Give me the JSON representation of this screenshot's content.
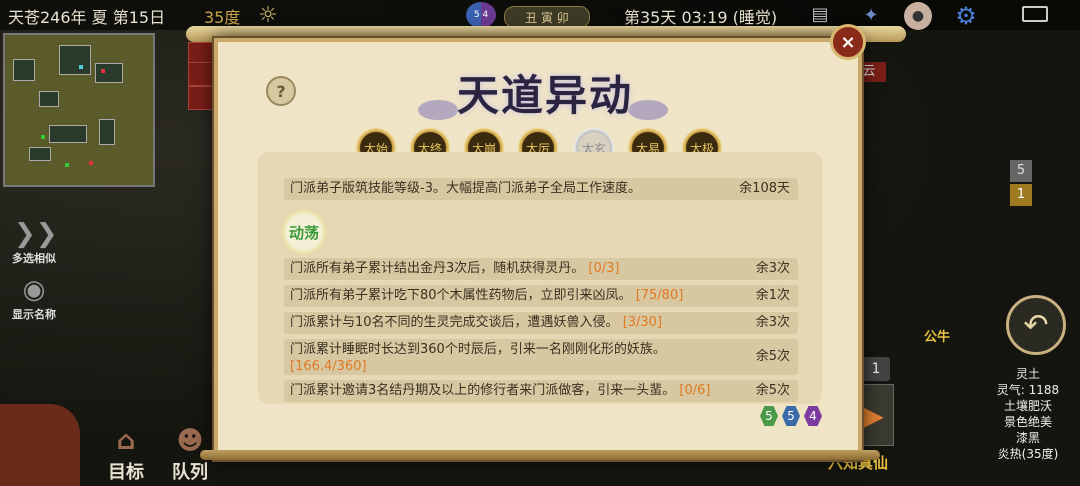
{
  "topbar": {
    "date": "天苍246年 夏 第15日",
    "temperature": "35度",
    "zodiac": "丑 寅 卯",
    "day_time": "第35天 03:19 (睡觉)",
    "yinyang_numbers": [
      "5",
      "4"
    ]
  },
  "left_buttons": [
    {
      "label": "多选相似",
      "icon": "multi-select-icon"
    },
    {
      "label": "显示名称",
      "icon": "eye-icon"
    }
  ],
  "bottom_buttons": [
    {
      "label": "目标"
    },
    {
      "label": "队列"
    }
  ],
  "right_strip_label": "云",
  "panel": {
    "title": "天道异动",
    "close_label": "×",
    "help_label": "?",
    "tabs": [
      "太始",
      "太终",
      "太崩",
      "太厉",
      "太玄",
      "太易",
      "太极"
    ],
    "active_tab_index": 4,
    "main_event": {
      "text": "门派弟子版筑技能等级-3。大幅提高门派弟子全局工作速度。",
      "remaining": "余108天"
    },
    "section_badge": "动荡",
    "events": [
      {
        "text": "门派所有弟子累计结出金丹3次后，随机获得灵丹。",
        "progress": "[0/3]",
        "remaining": "余3次"
      },
      {
        "text": "门派所有弟子累计吃下80个木属性药物后，立即引来凶凤。",
        "progress": "[75/80]",
        "remaining": "余1次"
      },
      {
        "text": "门派累计与10名不同的生灵完成交谈后，遭遇妖兽入侵。",
        "progress": "[3/30]",
        "remaining": "余3次"
      },
      {
        "text": "门派累计睡眠时长达到360个时辰后，引来一名刚刚化形的妖族。",
        "progress": "[166.4/360]",
        "remaining": "余5次"
      },
      {
        "text": "门派累计邀请3名结丹期及以上的修行者来门派做客，引来一头蜚。",
        "progress": "[0/6]",
        "remaining": "余5次"
      }
    ],
    "badges": [
      {
        "value": "5",
        "color": "#4a9a4a"
      },
      {
        "value": "5",
        "color": "#3a6aa8"
      },
      {
        "value": "4",
        "color": "#7a3aa0"
      }
    ]
  },
  "right_panel": {
    "flag_top": "5",
    "flag_bottom": "1",
    "gender": "公牛",
    "counter": "1",
    "immortal_label": "六知真仙",
    "soil_info": [
      "灵土",
      "灵气: 1188",
      "土壤肥沃",
      "景色绝美",
      "漆黑",
      "炎热(35度)"
    ]
  },
  "colors": {
    "panel_bg": "#efe4c6",
    "progress": "#e07820",
    "accent_gold": "#e8c040"
  }
}
